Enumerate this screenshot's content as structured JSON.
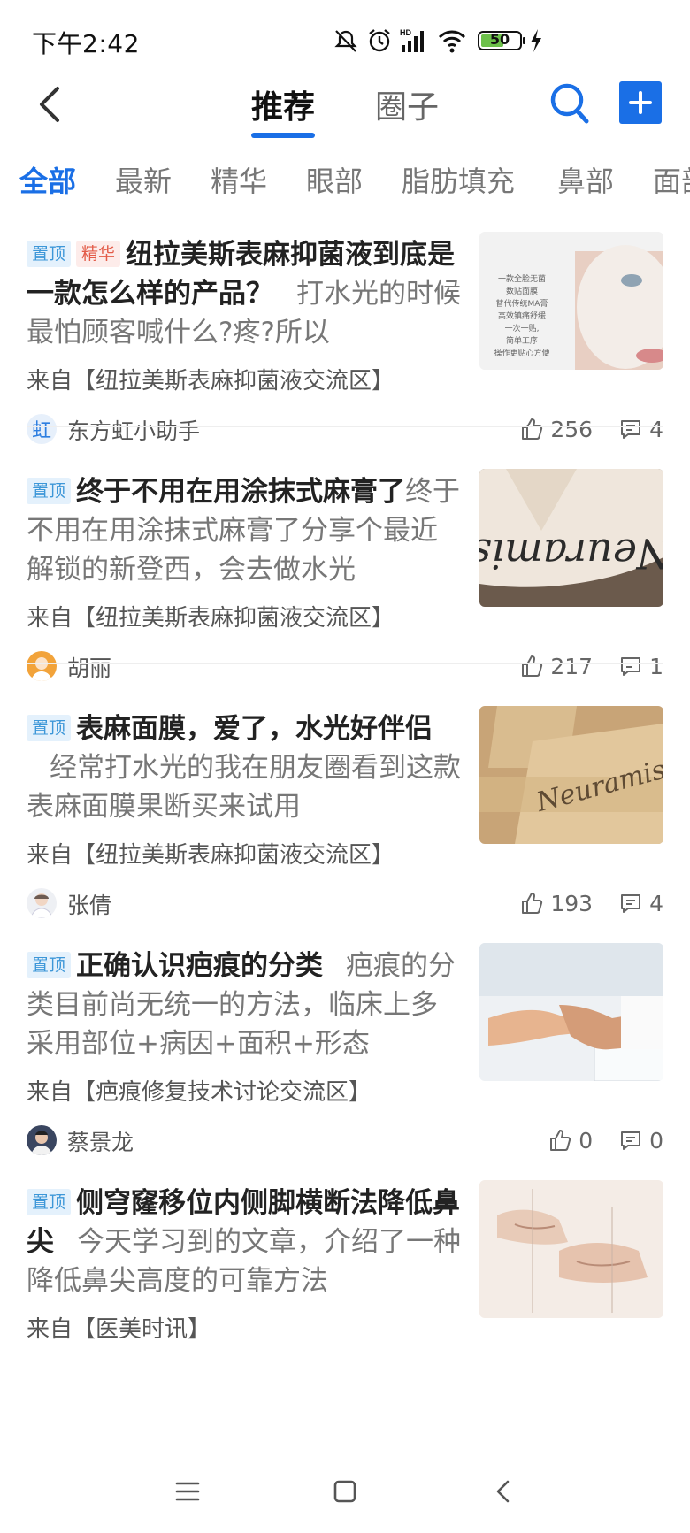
{
  "status_bar": {
    "time": "下午2:42",
    "battery_level": "50"
  },
  "nav": {
    "tabs": [
      {
        "label": "推荐",
        "active": true
      },
      {
        "label": "圈子",
        "active": false
      }
    ],
    "accent_color": "#1a6fe6",
    "icons": [
      "back-arrow-icon",
      "search-icon",
      "add-icon"
    ]
  },
  "categories": [
    {
      "label": "全部",
      "active": true
    },
    {
      "label": "最新"
    },
    {
      "label": "精华"
    },
    {
      "label": "眼部"
    },
    {
      "label": "脂肪填充"
    },
    {
      "label": "鼻部"
    },
    {
      "label": "面部"
    }
  ],
  "posts": [
    {
      "badges": [
        "置顶",
        "精华"
      ],
      "title": "纽拉美斯表麻抑菌液到底是一款怎么样的产品？",
      "excerpt": "打水光的时候最怕顾客喊什么?疼?所以",
      "source": "来自【纽拉美斯表麻抑菌液交流区】",
      "author": "东方虹小助手",
      "likes": "256",
      "comments": "4",
      "thumb_lines": [
        "一款全脸无菌",
        "数贴面膜",
        "替代传统MA膏",
        "高效镇痛舒缓",
        "一次一贴,",
        "简单工序",
        "操作更贴心方便"
      ]
    },
    {
      "badges": [
        "置顶"
      ],
      "title": "终于不用在用涂抹式麻膏了",
      "excerpt": "终于不用在用涂抹式麻膏了分享个最近解锁的新登西，会去做水光",
      "source": "来自【纽拉美斯表麻抑菌液交流区】",
      "author": "胡丽",
      "likes": "217",
      "comments": "1",
      "thumb_text": "Neuramis"
    },
    {
      "badges": [
        "置顶"
      ],
      "title": "表麻面膜，爱了，水光好伴侣",
      "excerpt": "经常打水光的我在朋友圈看到这款表麻面膜果断买来试用",
      "source": "来自【纽拉美斯表麻抑菌液交流区】",
      "author": "张倩",
      "likes": "193",
      "comments": "4",
      "thumb_text": "Neuramis"
    },
    {
      "badges": [
        "置顶"
      ],
      "title": "正确认识疤痕的分类",
      "excerpt": "疤痕的分类目前尚无统一的方法，临床上多采用部位+病因+面积+形态",
      "source": "来自【疤痕修复技术讨论交流区】",
      "author": "蔡景龙",
      "likes": "0",
      "comments": "0"
    },
    {
      "badges": [
        "置顶"
      ],
      "title": "侧穹窿移位内侧脚横断法降低鼻尖",
      "excerpt": "今天学习到的文章，介绍了一种降低鼻尖高度的可靠方法",
      "source": "来自【医美时讯】"
    }
  ]
}
